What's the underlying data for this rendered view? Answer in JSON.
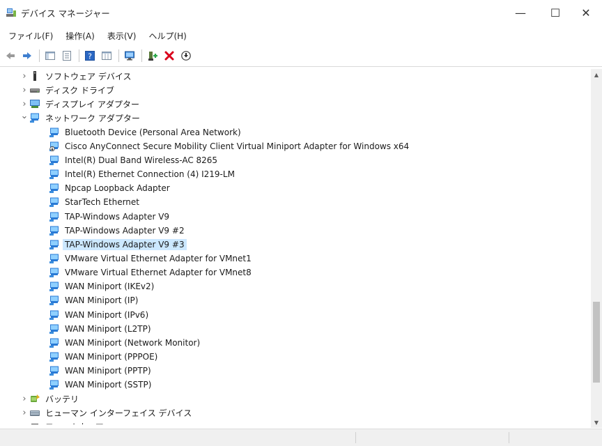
{
  "window": {
    "title": "デバイス マネージャー",
    "controls": {
      "minimize": "—",
      "maximize": "☐",
      "close": "✕"
    }
  },
  "menu": [
    {
      "label": "ファイル(F)"
    },
    {
      "label": "操作(A)"
    },
    {
      "label": "表示(V)"
    },
    {
      "label": "ヘルプ(H)"
    }
  ],
  "colors": {
    "selection": "#cce8ff",
    "remove_red": "#d9001b",
    "network_blue": "#2a7ad5"
  },
  "tree": {
    "items": [
      {
        "label": "ソフトウェア デバイス",
        "icon": "software-device-icon",
        "level": 0,
        "expander": "collapsed"
      },
      {
        "label": "ディスク ドライブ",
        "icon": "disk-drive-icon",
        "level": 0,
        "expander": "collapsed"
      },
      {
        "label": "ディスプレイ アダプター",
        "icon": "display-adapter-icon",
        "level": 0,
        "expander": "collapsed"
      },
      {
        "label": "ネットワーク アダプター",
        "icon": "network-adapter-icon",
        "level": 0,
        "expander": "expanded"
      },
      {
        "label": "Bluetooth Device (Personal Area Network)",
        "icon": "network-adapter-icon",
        "level": 1
      },
      {
        "label": "Cisco AnyConnect Secure Mobility Client Virtual Miniport Adapter for Windows x64",
        "icon": "network-adapter-disabled-icon",
        "level": 1
      },
      {
        "label": "Intel(R) Dual Band Wireless-AC 8265",
        "icon": "network-adapter-icon",
        "level": 1
      },
      {
        "label": "Intel(R) Ethernet Connection (4) I219-LM",
        "icon": "network-adapter-icon",
        "level": 1
      },
      {
        "label": "Npcap Loopback Adapter",
        "icon": "network-adapter-icon",
        "level": 1
      },
      {
        "label": "StarTech Ethernet",
        "icon": "network-adapter-icon",
        "level": 1
      },
      {
        "label": "TAP-Windows Adapter V9",
        "icon": "network-adapter-icon",
        "level": 1
      },
      {
        "label": "TAP-Windows Adapter V9 #2",
        "icon": "network-adapter-icon",
        "level": 1
      },
      {
        "label": "TAP-Windows Adapter V9 #3",
        "icon": "network-adapter-icon",
        "level": 1,
        "selected": true
      },
      {
        "label": "VMware Virtual Ethernet Adapter for VMnet1",
        "icon": "network-adapter-icon",
        "level": 1
      },
      {
        "label": "VMware Virtual Ethernet Adapter for VMnet8",
        "icon": "network-adapter-icon",
        "level": 1
      },
      {
        "label": "WAN Miniport (IKEv2)",
        "icon": "network-adapter-icon",
        "level": 1
      },
      {
        "label": "WAN Miniport (IP)",
        "icon": "network-adapter-icon",
        "level": 1
      },
      {
        "label": "WAN Miniport (IPv6)",
        "icon": "network-adapter-icon",
        "level": 1
      },
      {
        "label": "WAN Miniport (L2TP)",
        "icon": "network-adapter-icon",
        "level": 1
      },
      {
        "label": "WAN Miniport (Network Monitor)",
        "icon": "network-adapter-icon",
        "level": 1
      },
      {
        "label": "WAN Miniport (PPPOE)",
        "icon": "network-adapter-icon",
        "level": 1
      },
      {
        "label": "WAN Miniport (PPTP)",
        "icon": "network-adapter-icon",
        "level": 1
      },
      {
        "label": "WAN Miniport (SSTP)",
        "icon": "network-adapter-icon",
        "level": 1
      },
      {
        "label": "バッテリ",
        "icon": "battery-icon",
        "level": 0,
        "expander": "collapsed"
      },
      {
        "label": "ヒューマン インターフェイス デバイス",
        "icon": "hid-icon",
        "level": 0,
        "expander": "collapsed"
      },
      {
        "label": "ファームウェア",
        "icon": "firmware-icon",
        "level": 0,
        "expander": "collapsed"
      }
    ]
  }
}
